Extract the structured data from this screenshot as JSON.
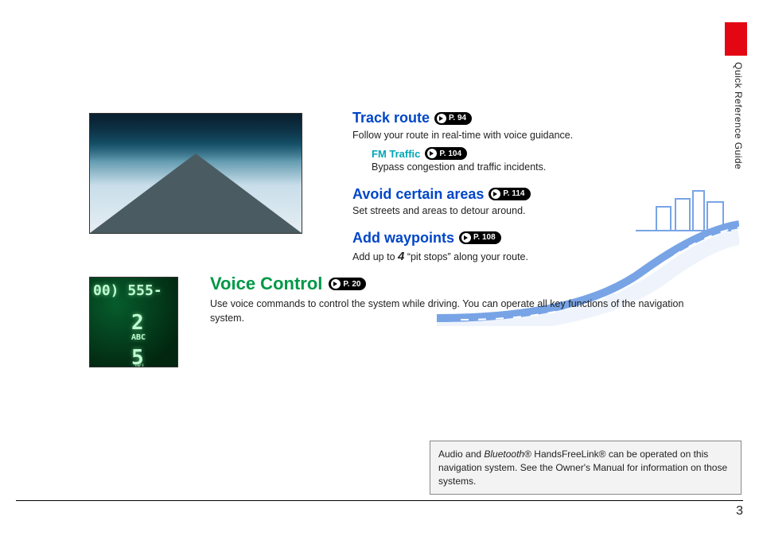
{
  "side_label": "Quick Reference Guide",
  "sections": {
    "track": {
      "title": "Track route",
      "page": "P. 94",
      "desc": "Follow your route in real-time with voice guidance.",
      "fm": {
        "title": "FM Traffic",
        "page": "P. 104",
        "desc": "Bypass congestion and traffic incidents."
      }
    },
    "avoid": {
      "title": "Avoid certain areas",
      "page": "P. 114",
      "desc": "Set streets and areas to detour around."
    },
    "waypoints": {
      "title": "Add waypoints",
      "page": "P. 108",
      "desc_pre": "Add up to ",
      "desc_num": "4",
      "desc_post": " “pit stops” along your route."
    },
    "voice": {
      "title": "Voice Control",
      "page": "P. 20",
      "desc": "Use voice commands to control the system while driving. You can operate all key functions of the navigation system."
    }
  },
  "note": {
    "pre": "Audio and ",
    "bt": "Bluetooth",
    "post": "® HandsFreeLink® can be operated on this navigation system. See the Owner's Manual for information on those systems."
  },
  "phone_overlay": {
    "top": "00) 555-",
    "key2": "2",
    "abc": "ABC",
    "key5": "5",
    "jkl": "JKL"
  },
  "page_number": "3"
}
